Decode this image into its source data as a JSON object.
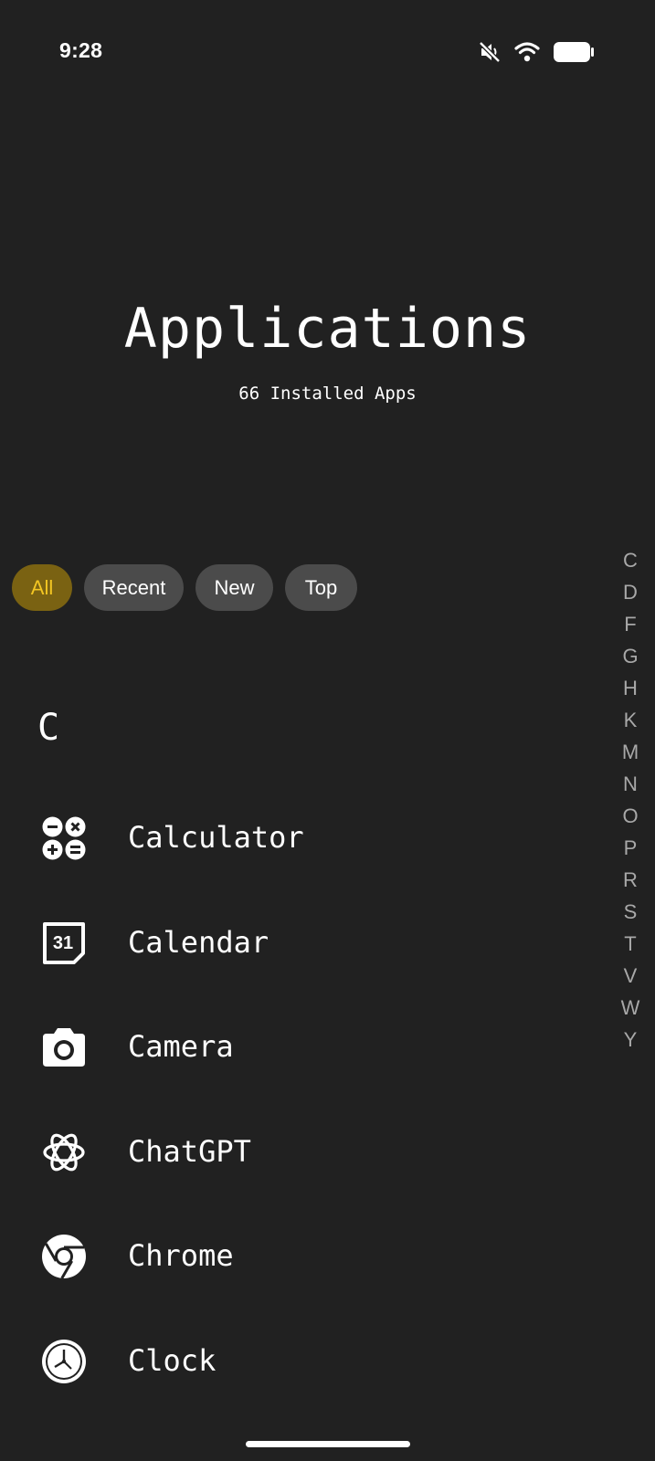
{
  "status_bar": {
    "time": "9:28",
    "icons": [
      "mute-icon",
      "wifi-icon",
      "battery-icon"
    ]
  },
  "header": {
    "title": "Applications",
    "subtitle": "66 Installed Apps"
  },
  "filters": [
    {
      "label": "All",
      "active": true
    },
    {
      "label": "Recent",
      "active": false
    },
    {
      "label": "New",
      "active": false
    },
    {
      "label": "Top",
      "active": false
    }
  ],
  "alphabet_index": [
    "C",
    "D",
    "F",
    "G",
    "H",
    "K",
    "M",
    "N",
    "O",
    "P",
    "R",
    "S",
    "T",
    "V",
    "W",
    "Y"
  ],
  "section": {
    "letter": "C",
    "apps": [
      {
        "name": "Calculator",
        "icon": "calculator-icon"
      },
      {
        "name": "Calendar",
        "icon": "calendar-icon",
        "icon_text": "31"
      },
      {
        "name": "Camera",
        "icon": "camera-icon"
      },
      {
        "name": "ChatGPT",
        "icon": "chatgpt-icon"
      },
      {
        "name": "Chrome",
        "icon": "chrome-icon"
      },
      {
        "name": "Clock",
        "icon": "clock-icon"
      }
    ]
  },
  "colors": {
    "background": "#212121",
    "chip_active_bg": "#7a6212",
    "chip_active_text": "#f3c623",
    "chip_bg": "#4b4b4b",
    "index_letter": "#a8a8a8"
  }
}
